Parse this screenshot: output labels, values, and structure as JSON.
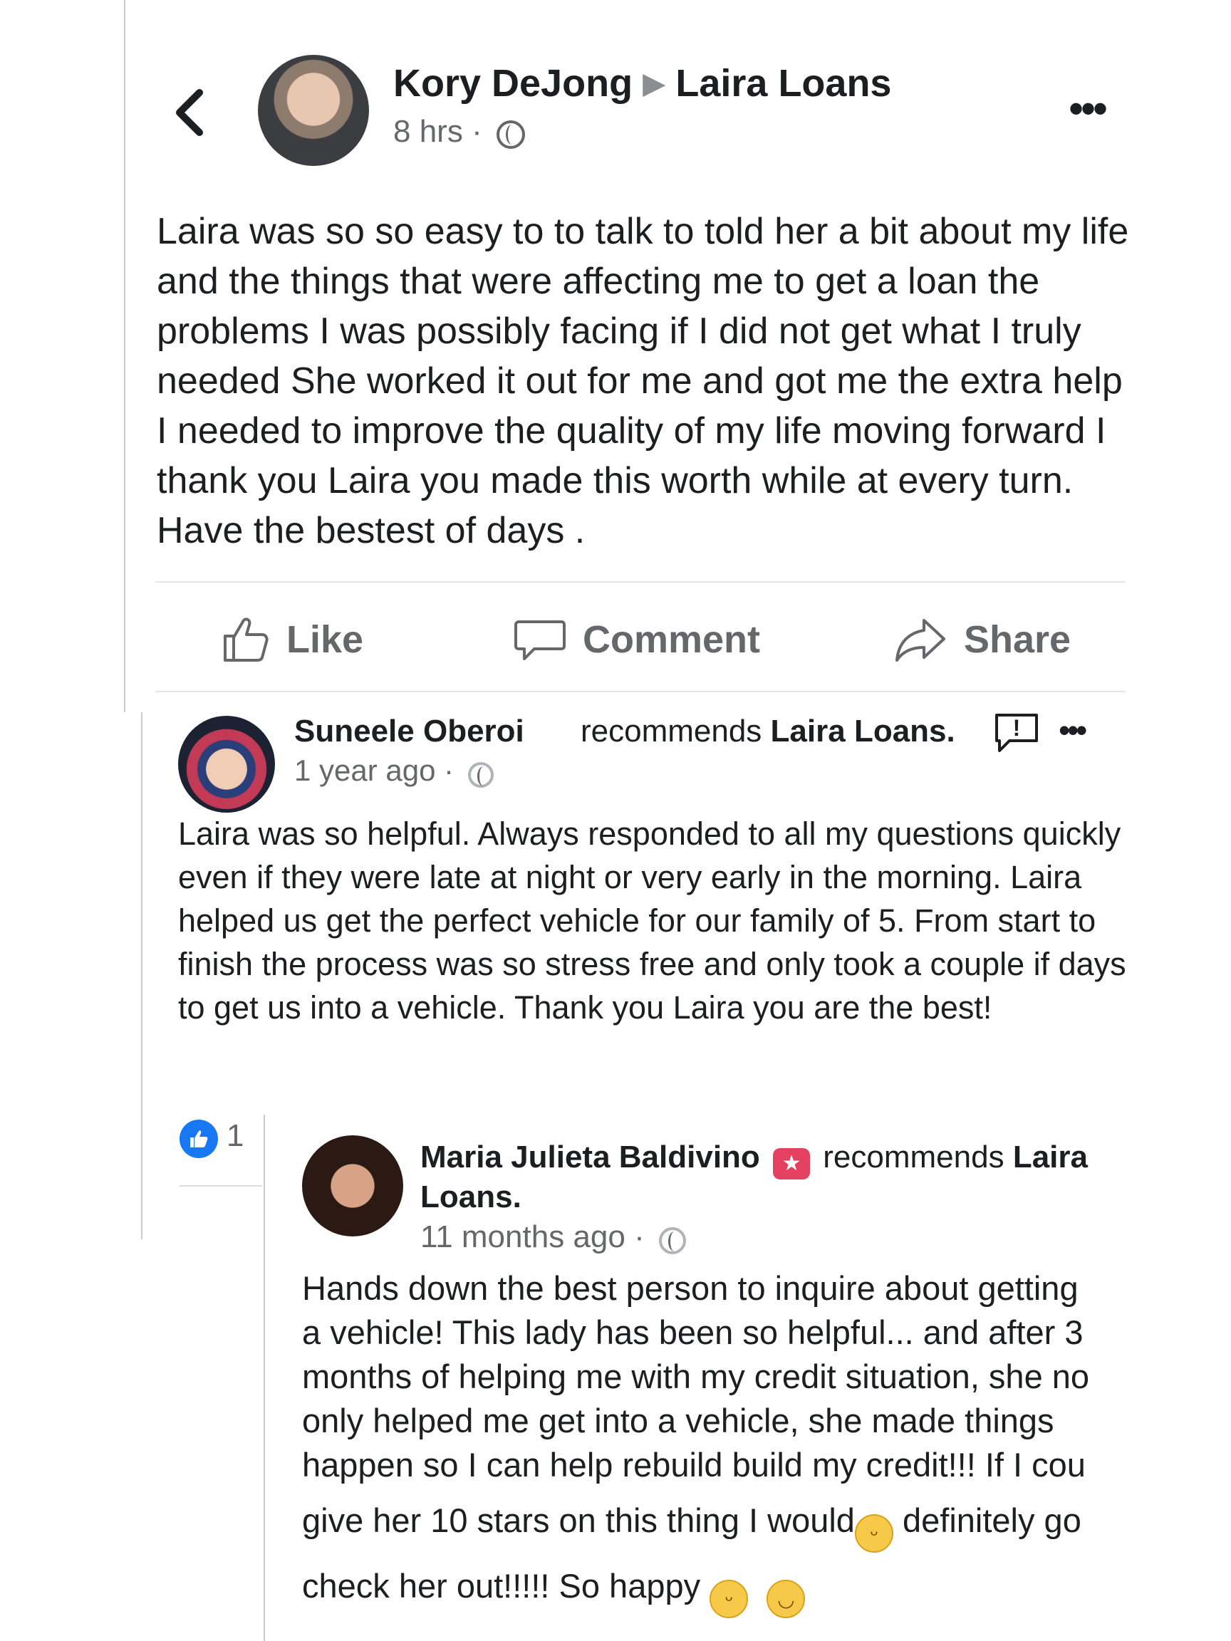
{
  "post": {
    "author": "Kory DeJong",
    "target": "Laira Loans",
    "time": "8 hrs",
    "separator": "·",
    "text": "Laira was so so easy to to talk to told her a bit about my life and the things that were affecting me to get a loan the problems I was possibly facing if I did not get what I truly needed   She worked it out for me and got me the extra help I needed to improve the quality of my life moving forward I thank you Laira you made this worth while at every turn. Have the bestest of days .",
    "actions": {
      "like": "Like",
      "comment": "Comment",
      "share": "Share"
    },
    "more": "•••"
  },
  "review1": {
    "name": "Suneele Oberoi",
    "recommends_prefix": "recommends",
    "page": "Laira Loans.",
    "time": "1 year ago",
    "separator": "·",
    "text": "Laira was so helpful.  Always responded to all my questions quickly even if they were late at night or very early in the morning. Laira helped us get the perfect vehicle for our family of 5.  From start to finish the process was so stress free and only took a couple if days to get us into a vehicle.  Thank you Laira you are the best!",
    "flag": "!",
    "more": "•••",
    "like_count": "1"
  },
  "review2": {
    "name": "Maria Julieta Baldivino",
    "recommends_prefix": "recommends",
    "page": "Laira Loans.",
    "time": "11 months ago",
    "separator": "·",
    "text_lines": [
      "Hands down the best person to inquire about getting",
      "a vehicle! This lady has been so helpful... and after 3",
      "months of helping me with my credit situation, she no",
      "only helped me get into a vehicle, she made things",
      "happen so I can help rebuild build my credit!!! If I cou"
    ],
    "line6_a": "give her 10 stars on this thing I would",
    "line6_b": " definitely go",
    "line7": "check her out!!!!! So happy "
  }
}
